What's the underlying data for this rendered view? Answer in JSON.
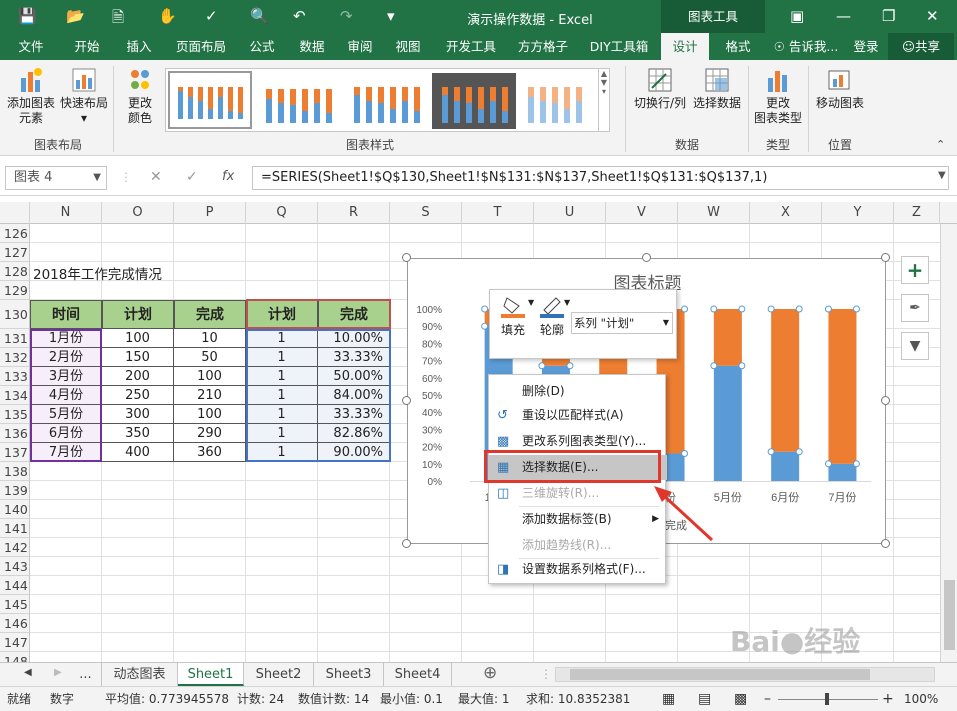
{
  "title_bar": {
    "title": "演示操作数据 - Excel",
    "context_tab": "图表工具"
  },
  "tabs": [
    "文件",
    "开始",
    "插入",
    "页面布局",
    "公式",
    "数据",
    "审阅",
    "视图",
    "开发工具",
    "方方格子",
    "DIY工具箱",
    "设计",
    "格式"
  ],
  "active_tab": "设计",
  "tell_me": "告诉我...",
  "login": "登录",
  "share": "共享",
  "ribbon": {
    "add_element": [
      "添加图表",
      "元素"
    ],
    "quick_layout": "快速布局",
    "change_colors": [
      "更改",
      "颜色"
    ],
    "group_layout": "图表布局",
    "group_styles": "图表样式",
    "switch_row_col": "切换行/列",
    "select_data": "选择数据",
    "group_data": "数据",
    "change_type": [
      "更改",
      "图表类型"
    ],
    "group_type": "类型",
    "move_chart": "移动图表",
    "group_location": "位置"
  },
  "formula_bar": {
    "name_box": "图表 4",
    "fx": "fx",
    "formula": "=SERIES(Sheet1!$Q$130,Sheet1!$N$131:$N$137,Sheet1!$Q$131:$Q$137,1)"
  },
  "columns": [
    "N",
    "O",
    "P",
    "Q",
    "R",
    "S",
    "T",
    "U",
    "V",
    "W",
    "X",
    "Y",
    "Z"
  ],
  "rows": [
    "126",
    "127",
    "128",
    "129",
    "130",
    "131",
    "132",
    "133",
    "134",
    "135",
    "136",
    "137",
    "138",
    "139",
    "140",
    "141",
    "142",
    "143",
    "144",
    "145",
    "146",
    "147",
    "148"
  ],
  "sheet": {
    "title": "2018年工作完成情况",
    "headers": [
      "时间",
      "计划",
      "完成",
      "计划",
      "完成"
    ],
    "data": [
      [
        "1月份",
        "100",
        "10",
        "1",
        "10.00%"
      ],
      [
        "2月份",
        "150",
        "50",
        "1",
        "33.33%"
      ],
      [
        "3月份",
        "200",
        "100",
        "1",
        "50.00%"
      ],
      [
        "4月份",
        "250",
        "210",
        "1",
        "84.00%"
      ],
      [
        "5月份",
        "300",
        "100",
        "1",
        "33.33%"
      ],
      [
        "6月份",
        "350",
        "290",
        "1",
        "82.86%"
      ],
      [
        "7月份",
        "400",
        "360",
        "1",
        "90.00%"
      ]
    ]
  },
  "chart_data": {
    "type": "bar",
    "stacked": "percent",
    "title": "图表标题",
    "categories": [
      "1月份",
      "2月份",
      "3月份",
      "4月份",
      "5月份",
      "6月份",
      "7月份"
    ],
    "visible_category_labels": [
      "1月份",
      "",
      "",
      "份",
      "5月份",
      "6月份",
      "7月份"
    ],
    "y_ticks": [
      "0%",
      "10%",
      "20%",
      "30%",
      "40%",
      "50%",
      "60%",
      "70%",
      "80%",
      "90%",
      "100%"
    ],
    "ylim": [
      0,
      1
    ],
    "grid": false,
    "legend_fragment": "完成",
    "series": [
      {
        "name": "完成",
        "color": "#5b9bd5",
        "values": [
          0.9,
          0.67,
          0.5,
          0.16,
          0.67,
          0.17,
          0.1
        ]
      },
      {
        "name": "计划",
        "color": "#ed7d31",
        "values": [
          0.1,
          0.33,
          0.5,
          0.84,
          0.33,
          0.83,
          0.9
        ]
      }
    ]
  },
  "mini_toolbar": {
    "fill": "填充",
    "outline": "轮廓",
    "series_select": "系列 \"计划\""
  },
  "context_menu": [
    {
      "label": "删除(D)",
      "enabled": true,
      "icon": "none"
    },
    {
      "label": "重设以匹配样式(A)",
      "enabled": true,
      "icon": "reset-icon"
    },
    {
      "label": "更改系列图表类型(Y)...",
      "enabled": true,
      "icon": "chart-type-icon"
    },
    {
      "label": "选择数据(E)...",
      "enabled": true,
      "icon": "select-data-icon",
      "highlighted": true
    },
    {
      "label": "三维旋转(R)...",
      "enabled": false,
      "icon": "rotate-icon"
    },
    {
      "label": "添加数据标签(B)",
      "enabled": true,
      "icon": "none",
      "submenu": true
    },
    {
      "label": "添加趋势线(R)...",
      "enabled": false,
      "icon": "none"
    },
    {
      "label": "设置数据系列格式(F)...",
      "enabled": true,
      "icon": "format-icon"
    }
  ],
  "sheet_tabs": [
    "...",
    "动态图表",
    "Sheet1",
    "Sheet2",
    "Sheet3",
    "Sheet4"
  ],
  "active_sheet": "Sheet1",
  "status": {
    "ready": "就绪",
    "mode": "数字",
    "average": "平均值: 0.773945578",
    "count": "计数: 24",
    "num_count": "数值计数: 14",
    "min": "最小值: 0.1",
    "max": "最大值: 1",
    "sum": "求和: 10.8352381",
    "zoom": "100%"
  },
  "colors": {
    "excel_green": "#217346",
    "header_green": "#a9d18e",
    "plan_orange": "#ed7d31",
    "done_blue": "#5b9bd5",
    "highlight_red": "#e0362c"
  }
}
